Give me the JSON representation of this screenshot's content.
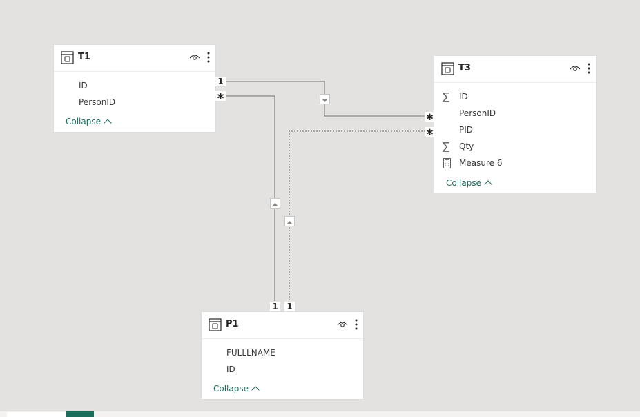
{
  "tables": {
    "t1": {
      "title": "T1",
      "fields": [
        "ID",
        "PersonID"
      ],
      "collapse": "Collapse"
    },
    "t3": {
      "title": "T3",
      "fields": [
        "ID",
        "PersonID",
        "PID",
        "Qty",
        "Measure 6"
      ],
      "collapse": "Collapse"
    },
    "p1": {
      "title": "P1",
      "fields": [
        "FULLLNAME",
        "ID"
      ],
      "collapse": "Collapse"
    }
  },
  "relationships": {
    "t1_one": "1",
    "t1_many": "∗",
    "t3_many_a": "∗",
    "t3_many_b": "∗",
    "p1_one_a": "1",
    "p1_one_b": "1"
  },
  "icons": {
    "table": "table-icon",
    "visibility": "eye-icon",
    "more": "more-options-icon",
    "sum": "sigma-icon",
    "measure": "calculator-icon"
  },
  "colors": {
    "canvas": "#e3e2e1",
    "accent": "#1a6b5c",
    "line": "#6f6e6d"
  }
}
